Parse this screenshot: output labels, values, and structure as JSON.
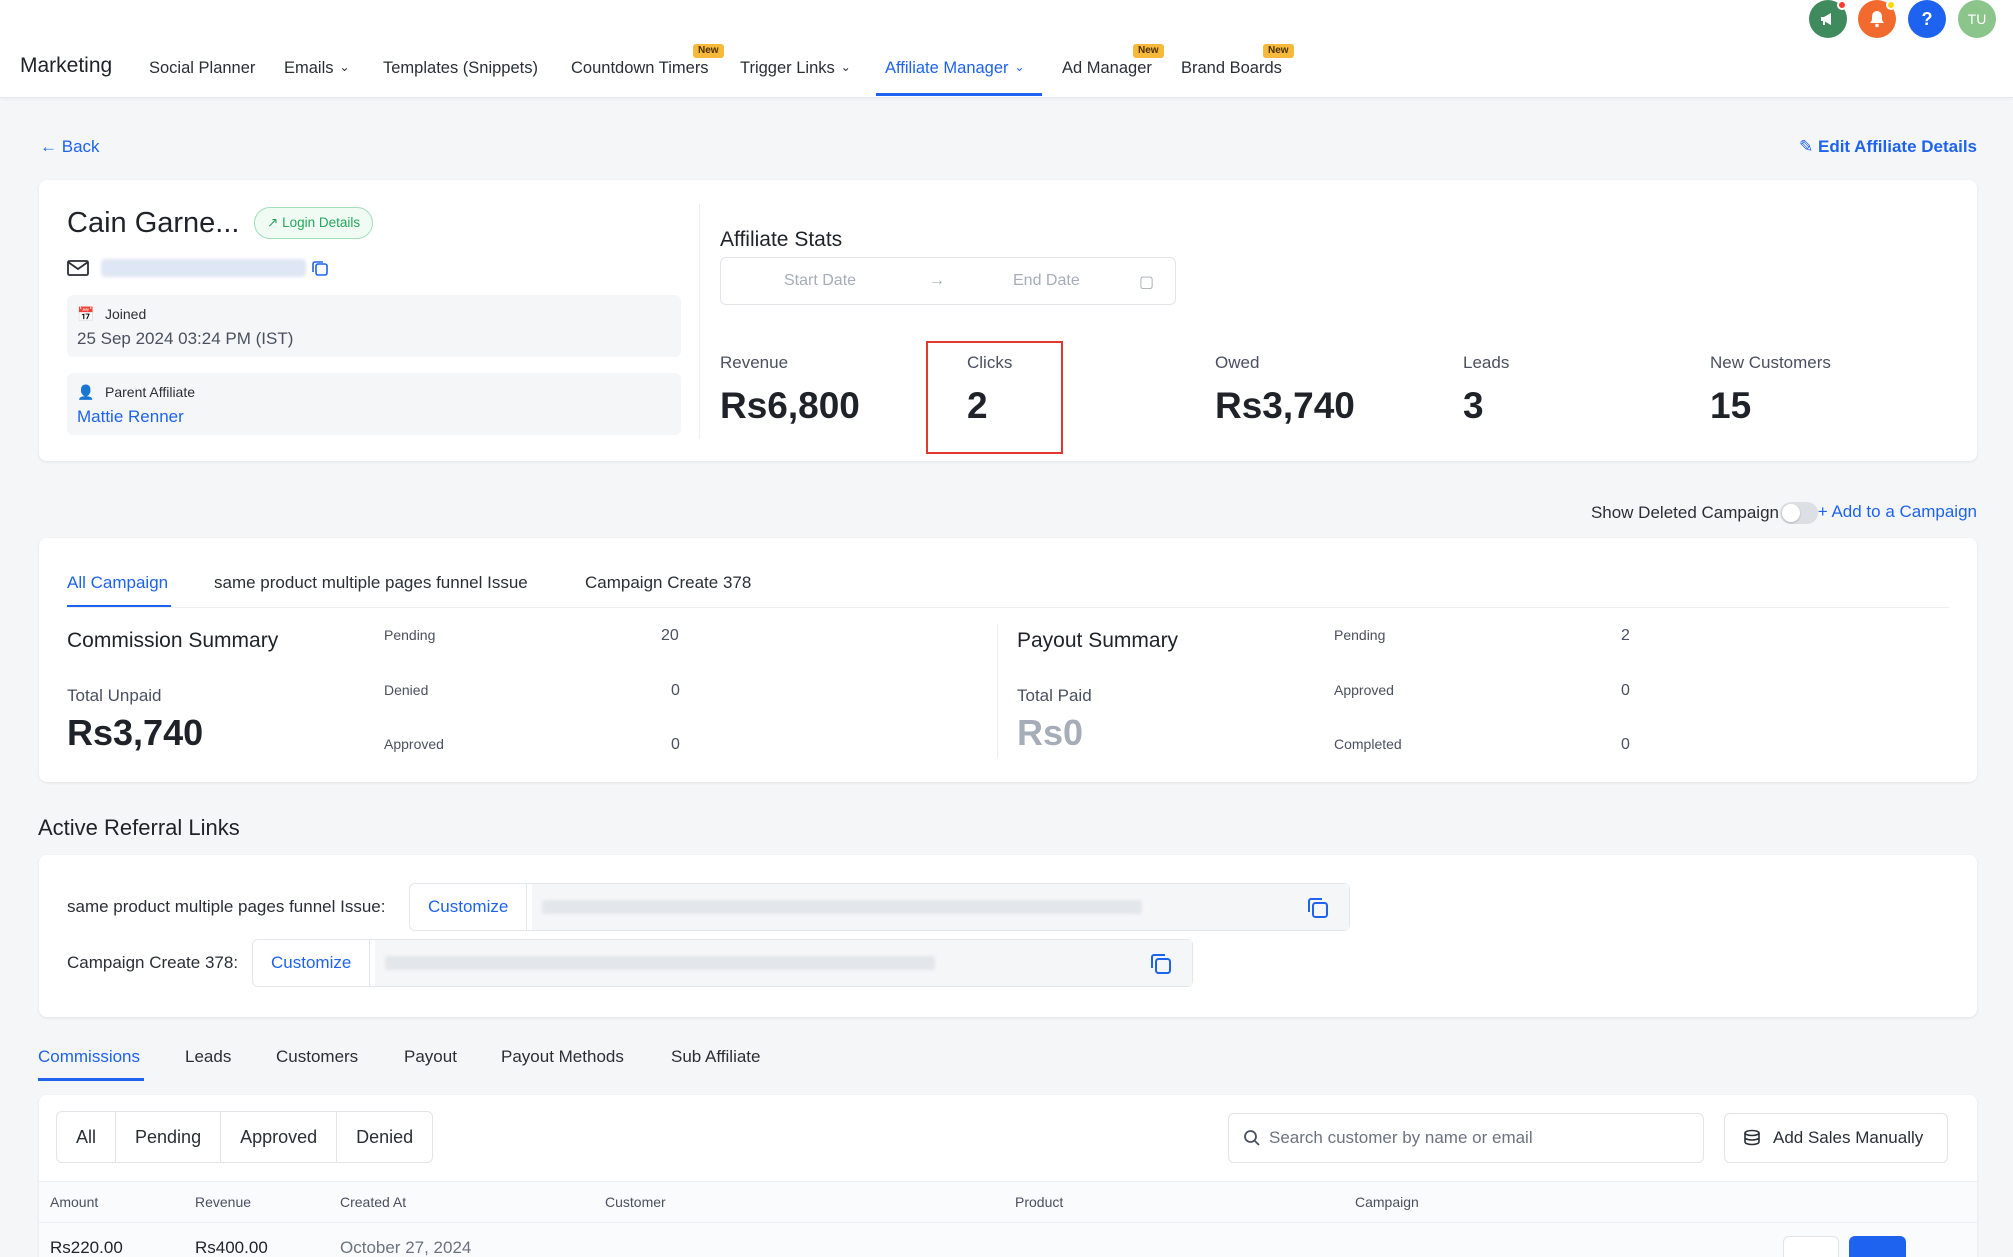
{
  "colors": {
    "accent": "#1e63f0",
    "highlight": "#e1392f",
    "success": "#26a85c",
    "badge": "#f6b93b"
  },
  "nav": {
    "brand": "Marketing",
    "items": [
      {
        "label": "Social Planner"
      },
      {
        "label": "Emails"
      },
      {
        "label": "Templates (Snippets)"
      },
      {
        "label": "Countdown Timers"
      },
      {
        "label": "Trigger Links"
      },
      {
        "label": "Affiliate Manager"
      },
      {
        "label": "Ad Manager"
      },
      {
        "label": "Brand Boards"
      }
    ],
    "new_badge": "New",
    "avatar_initials": "TU",
    "help_glyph": "?"
  },
  "page": {
    "back_label": "Back",
    "edit_label": "Edit Affiliate Details"
  },
  "affiliate": {
    "name": "Cain Garne...",
    "login_label": "Login Details",
    "joined_label": "Joined",
    "joined_value": "25 Sep 2024 03:24 PM (IST)",
    "parent_label": "Parent Affiliate",
    "parent_value": "Mattie Renner"
  },
  "stats": {
    "title": "Affiliate Stats",
    "start_placeholder": "Start Date",
    "end_placeholder": "End Date",
    "items": [
      {
        "label": "Revenue",
        "value": "Rs6,800"
      },
      {
        "label": "Clicks",
        "value": "2"
      },
      {
        "label": "Owed",
        "value": "Rs3,740"
      },
      {
        "label": "Leads",
        "value": "3"
      },
      {
        "label": "New Customers",
        "value": "15"
      }
    ]
  },
  "campaign_bar": {
    "toggle_label": "Show Deleted Campaign",
    "add_label": "Add to a Campaign"
  },
  "campaign_tabs": [
    "All Campaign",
    "same product multiple pages funnel Issue",
    "Campaign Create 378"
  ],
  "commission": {
    "title": "Commission Summary",
    "sub": "Total Unpaid",
    "big": "Rs3,740",
    "rows": [
      {
        "label": "Pending",
        "value": "20"
      },
      {
        "label": "Denied",
        "value": "0"
      },
      {
        "label": "Approved",
        "value": "0"
      }
    ]
  },
  "payout": {
    "title": "Payout Summary",
    "sub": "Total Paid",
    "big": "Rs0",
    "rows": [
      {
        "label": "Pending",
        "value": "2"
      },
      {
        "label": "Approved",
        "value": "0"
      },
      {
        "label": "Completed",
        "value": "0"
      }
    ]
  },
  "referral": {
    "title": "Active Referral Links",
    "customize_label": "Customize",
    "links": [
      {
        "label": "same product multiple pages funnel Issue:"
      },
      {
        "label": "Campaign Create 378:"
      }
    ]
  },
  "bottom_tabs": [
    "Commissions",
    "Leads",
    "Customers",
    "Payout",
    "Payout Methods",
    "Sub Affiliate"
  ],
  "filters": [
    "All",
    "Pending",
    "Approved",
    "Denied"
  ],
  "search": {
    "placeholder": "Search customer by name or email"
  },
  "add_sales_label": "Add Sales Manually",
  "table": {
    "headers": [
      "Amount",
      "Revenue",
      "Created At",
      "Customer",
      "Product",
      "Campaign"
    ],
    "first_row": {
      "amount": "Rs220.00",
      "revenue": "Rs400.00",
      "created": "October 27, 2024"
    }
  }
}
